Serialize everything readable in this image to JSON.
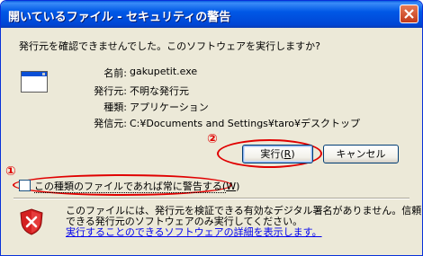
{
  "window": {
    "title": "開いているファイル - セキュリティの警告",
    "close_icon": "close-icon"
  },
  "question": "発行元を確認できませんでした。このソフトウェアを実行しますか?",
  "file_info": [
    {
      "label": "名前:",
      "value": "gakupetit.exe"
    },
    {
      "label": "発行元:",
      "value": "不明な発行元"
    },
    {
      "label": "種類:",
      "value": "アプリケーション"
    },
    {
      "label": "発信元:",
      "value": "C:¥Documents and Settings¥taro¥デスクトップ"
    }
  ],
  "buttons": {
    "run": {
      "label": "実行(",
      "key": "R",
      "suffix": ")"
    },
    "cancel": {
      "label": "キャンセル"
    }
  },
  "checkbox": {
    "label": "この種類のファイルであれば常に警告する(",
    "key": "W",
    "suffix": ")",
    "checked": false
  },
  "warning": {
    "line1": "このファイルには、発行元を検証できる有効なデジタル署名がありません。信頼",
    "line2": "できる発行元のソフトウェアのみ実行してください。",
    "link": "実行することのできるソフトウェアの詳細を表示します。"
  },
  "annotations": {
    "marker1": "①",
    "marker2": "②",
    "color": "#e00000"
  },
  "colors": {
    "titlebar": "#0058e6",
    "dialog_bg": "#ece9d8",
    "link": "#0000ee"
  }
}
